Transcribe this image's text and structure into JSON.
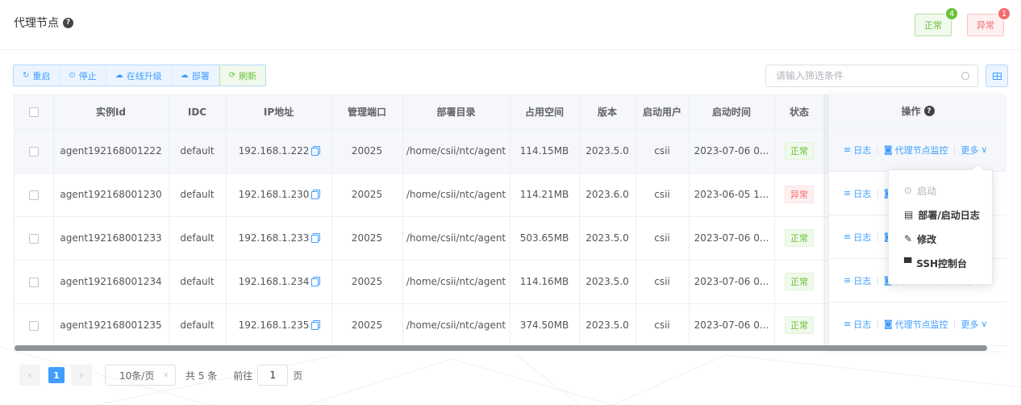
{
  "header": {
    "title": "代理节点",
    "status_normal": {
      "label": "正常",
      "count": "4",
      "color": "#67c23a"
    },
    "status_abnormal": {
      "label": "异常",
      "count": "1",
      "color": "#f56c6c"
    }
  },
  "toolbar": {
    "restart": "重启",
    "stop": "停止",
    "upgrade": "在线升级",
    "deploy": "部署",
    "refresh": "刷新"
  },
  "filter": {
    "placeholder": "请输入筛选条件"
  },
  "table": {
    "columns": [
      "实例Id",
      "IDC",
      "IP地址",
      "管理端口",
      "部署目录",
      "占用空间",
      "版本",
      "启动用户",
      "启动时间",
      "状态",
      "操作"
    ],
    "rows": [
      {
        "id": "agent192168001222",
        "idc": "default",
        "ip": "192.168.1.222",
        "port": "20025",
        "dir": "/home/csii/ntc/agent",
        "space": "114.15MB",
        "version": "2023.5.0",
        "user": "csii",
        "time": "2023-07-06 0...",
        "status": "正常"
      },
      {
        "id": "agent192168001230",
        "idc": "default",
        "ip": "192.168.1.230",
        "port": "20025",
        "dir": "/home/csii/ntc/agent",
        "space": "114.21MB",
        "version": "2023.6.0",
        "user": "csii",
        "time": "2023-06-05 1...",
        "status": "异常"
      },
      {
        "id": "agent192168001233",
        "idc": "default",
        "ip": "192.168.1.233",
        "port": "20025",
        "dir": "/home/csii/ntc/agent",
        "space": "503.65MB",
        "version": "2023.5.0",
        "user": "csii",
        "time": "2023-07-06 0...",
        "status": "正常"
      },
      {
        "id": "agent192168001234",
        "idc": "default",
        "ip": "192.168.1.234",
        "port": "20025",
        "dir": "/home/csii/ntc/agent",
        "space": "114.16MB",
        "version": "2023.5.0",
        "user": "csii",
        "time": "2023-07-06 0...",
        "status": "正常"
      },
      {
        "id": "agent192168001235",
        "idc": "default",
        "ip": "192.168.1.235",
        "port": "20025",
        "dir": "/home/csii/ntc/agent",
        "space": "374.50MB",
        "version": "2023.5.0",
        "user": "csii",
        "time": "2023-07-06 0...",
        "status": "正常"
      }
    ],
    "actions": {
      "log": "日志",
      "monitor": "代理节点监控",
      "more": "更多"
    }
  },
  "dropdown": {
    "items": [
      {
        "label": "启动",
        "icon": "play-circle-icon",
        "disabled": true
      },
      {
        "label": "部署/启动日志",
        "icon": "calendar-icon",
        "disabled": false
      },
      {
        "label": "修改",
        "icon": "edit-icon",
        "disabled": false
      },
      {
        "label": "SSH控制台",
        "icon": "monitor-icon",
        "disabled": false
      }
    ]
  },
  "pagination": {
    "current_page": "1",
    "page_size": "10条/页",
    "total": "共 5 条",
    "goto_prefix": "前往",
    "goto_value": "1",
    "goto_suffix": "页"
  },
  "colors": {
    "primary": "#409eff",
    "success": "#67c23a",
    "danger": "#f56c6c"
  }
}
